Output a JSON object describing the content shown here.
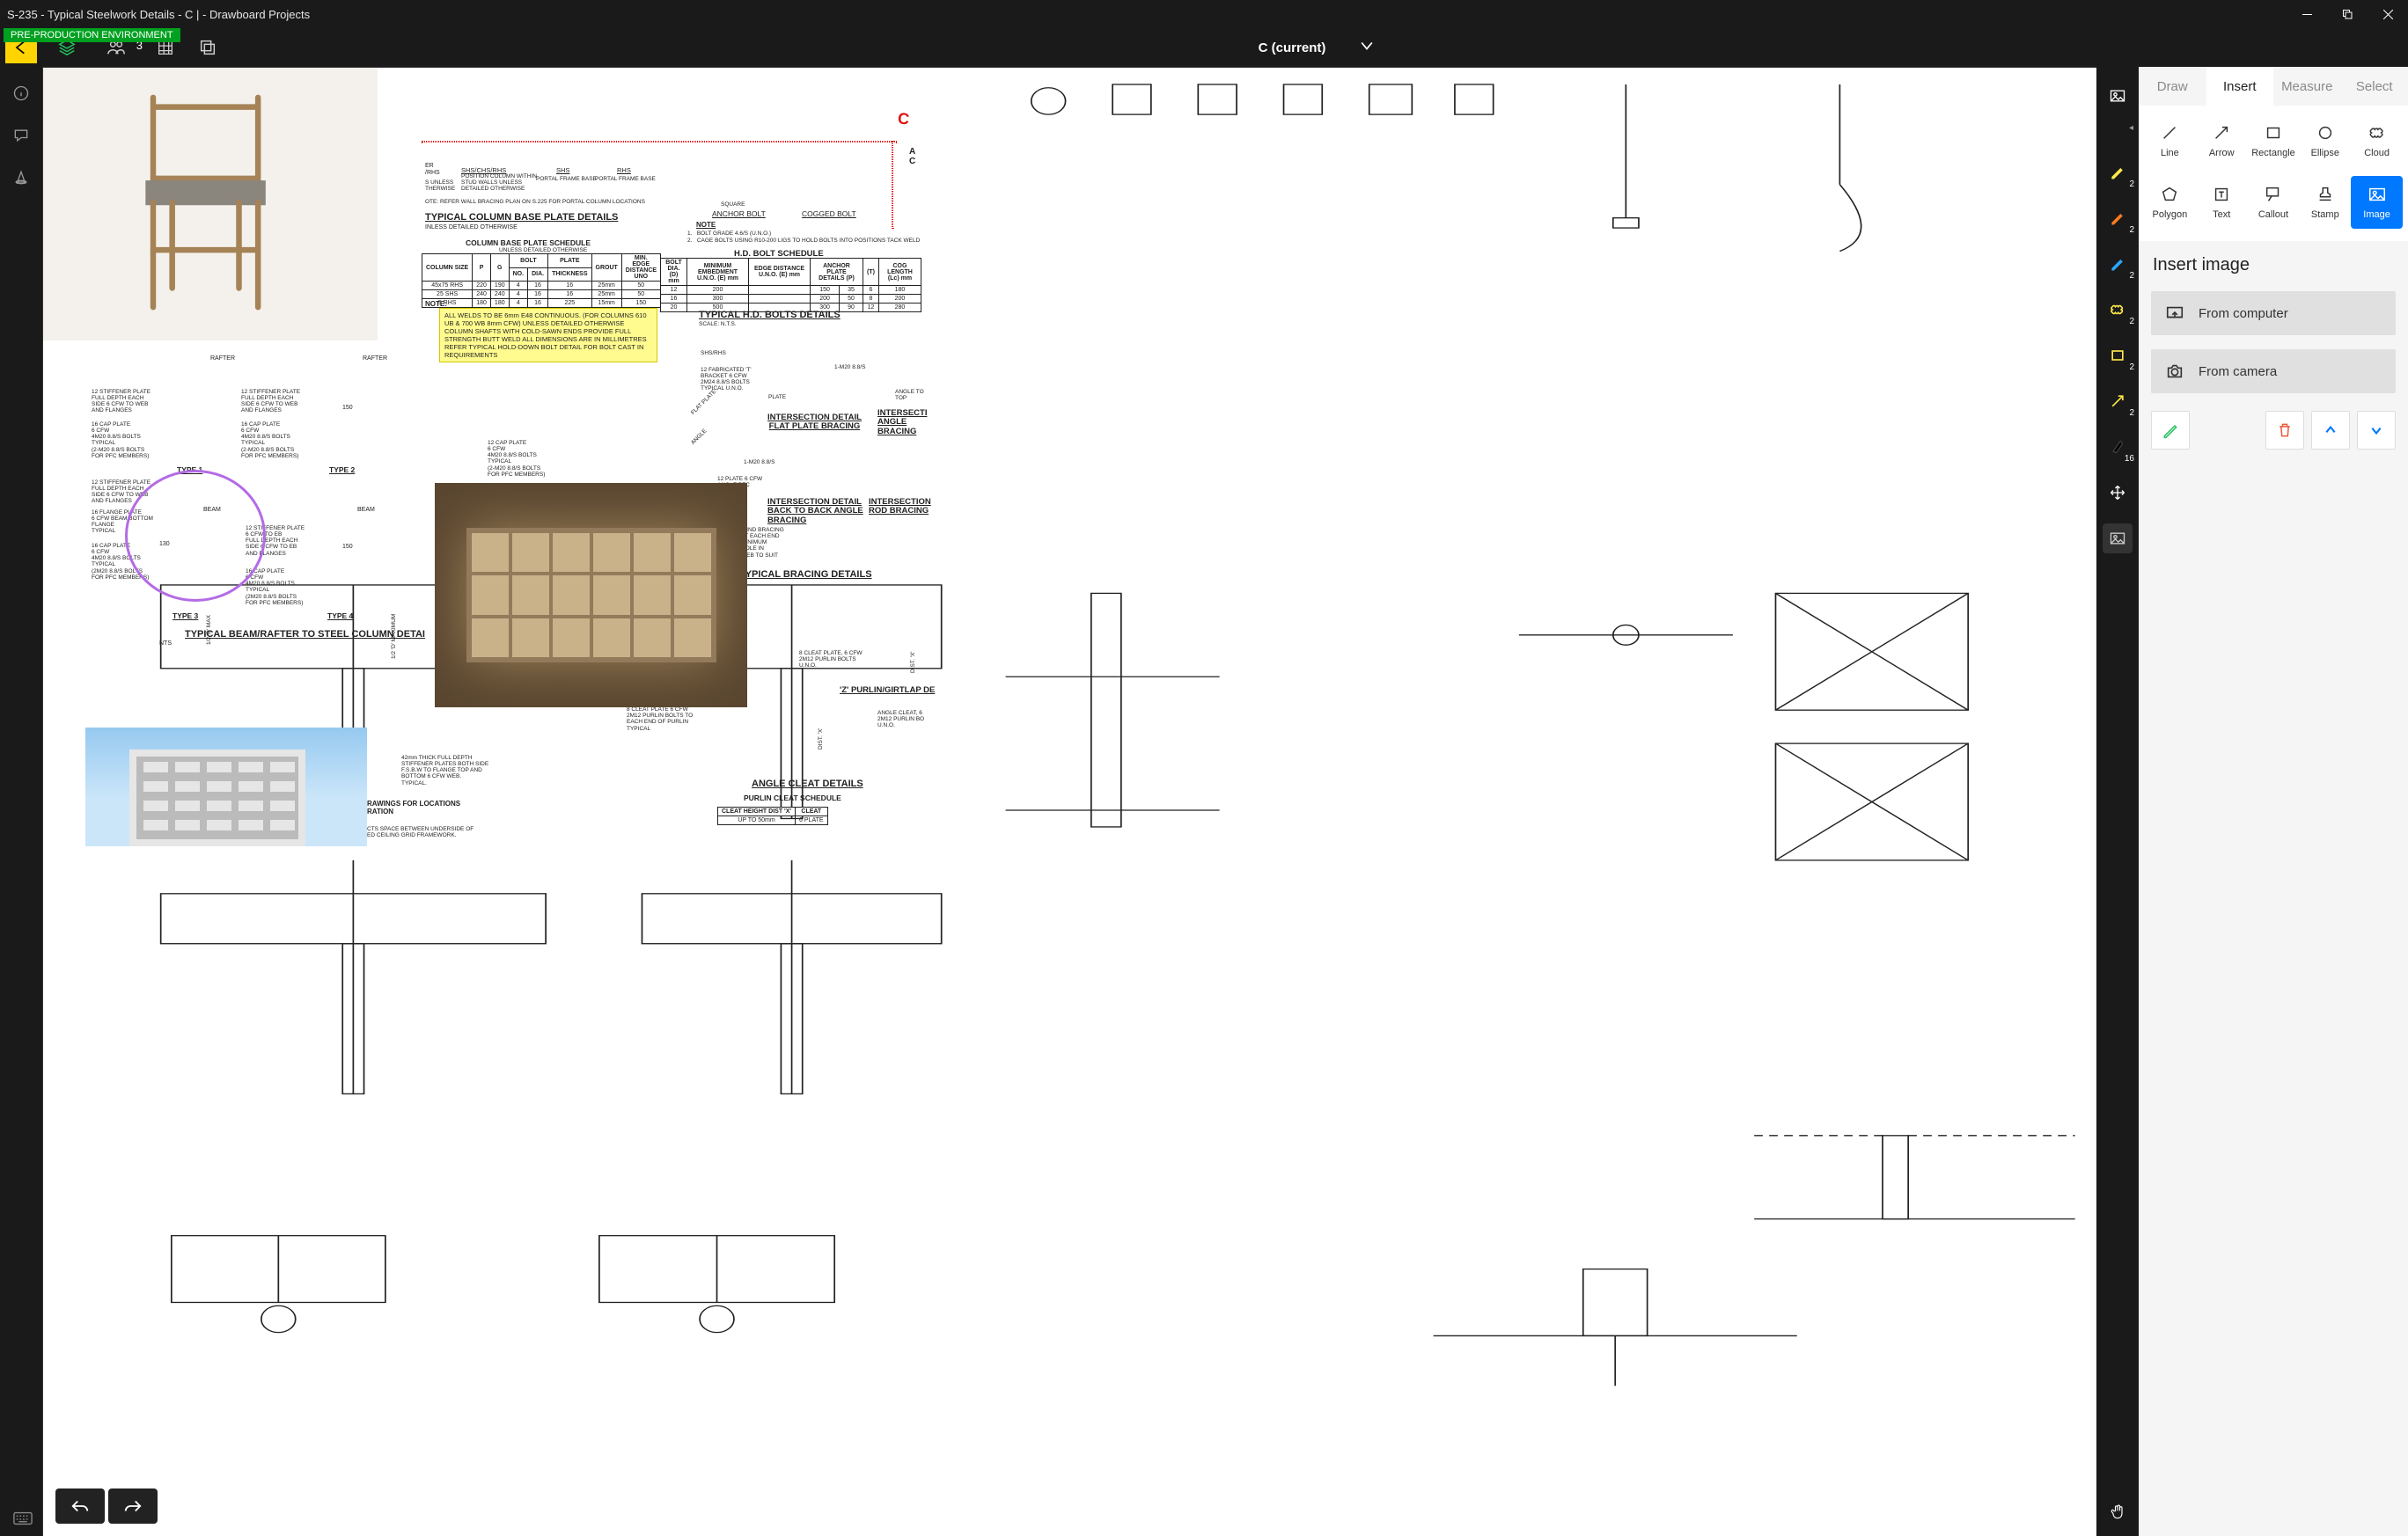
{
  "window": {
    "title": "S-235 - Typical Steelwork Details - C | - Drawboard Projects"
  },
  "env_banner": "PRE-PRODUCTION ENVIRONMENT",
  "topbar": {
    "people_count": "3",
    "revision_label": "C (current)"
  },
  "rightrail": {
    "pens": [
      {
        "color": "#ffe84a",
        "badge": "2"
      },
      {
        "color": "#ff7b1f",
        "badge": "2"
      },
      {
        "color": "#2aa7ff",
        "badge": "2"
      },
      {
        "color": "#ffe84a",
        "badge": "2",
        "square": true
      },
      {
        "color": "#ffe84a",
        "badge": "2",
        "outline": true
      },
      {
        "color": "#ffe84a",
        "badge": "2",
        "arrow": true
      }
    ],
    "ink_badge": "16"
  },
  "tabs": {
    "draw": "Draw",
    "insert": "Insert",
    "measure": "Measure",
    "select": "Select",
    "active": "insert"
  },
  "tools": {
    "line": "Line",
    "arrow": "Arrow",
    "rectangle": "Rectangle",
    "ellipse": "Ellipse",
    "cloud": "Cloud",
    "polygon": "Polygon",
    "text": "Text",
    "callout": "Callout",
    "stamp": "Stamp",
    "image": "Image",
    "selected": "image"
  },
  "insert_panel": {
    "header": "Insert image",
    "from_computer": "From computer",
    "from_camera": "From camera"
  },
  "drawing": {
    "chair_alt": "Dining chair product photo",
    "room_alt": "Interior pinboard photo",
    "building_alt": "Apartment building photo",
    "headers": {
      "col_base": "TYPICAL COLUMN BASE PLATE DETAILS",
      "base_plate_schedule": "COLUMN BASE PLATE SCHEDULE",
      "plate_note": "UNLESS DETAILED OTHERWISE",
      "hd_bolt_schedule": "H.D. BOLT SCHEDULE",
      "hd_bolts": "TYPICAL H.D. BOLTS DETAILS",
      "beam_rafter": "TYPICAL BEAM/RAFTER TO STEEL COLUMN DETAI",
      "intersection_flat": "INTERSECTION DETAIL\nFLAT PLATE BRACING",
      "intersection_angle": "INTERSECTI\nANGLE\nBRACING",
      "intersection_back": "INTERSECTION DETAIL\nBACK TO BACK ANGLE\nBRACING",
      "intersection_rod": "INTERSECTION\nROD BRACING",
      "typ_bracing": "TYPICAL BRACING DETAILS",
      "angle_cleat": "ANGLE CLEAT DETAILS",
      "purlin_sched": "PURLIN CLEAT SCHEDULE",
      "purlin_girtlap": "'Z' PURLIN/GIRTLAP DE",
      "type1": "TYPE 1",
      "type2": "TYPE 2",
      "type3": "TYPE 3",
      "type4": "TYPE 4",
      "nts": "NTS"
    },
    "small_labels": {
      "shs": "SHS",
      "rhs": "RHS",
      "shs_chs_rhs": "SHS/CHS/RHS",
      "portal_frame": "PORTAL FRAME BASE",
      "position_note": "POSITION COLUMN WITHIN\nSTUD WALLS UNLESS\nDETAILED OTHERWISE",
      "refer_wall": "OTE: REFER WALL BRACING PLAN ON S.225 FOR PORTAL COLUMN LOCATIONS",
      "weld_note": "ALL WELDS TO BE 6mm E48 CONTINUOUS. (FOR COLUMNS 610 UB & 700 WB 8mm CFW)\nUNLESS DETAILED OTHERWISE\nCOLUMN SHAFTS WITH COLD-SAWN ENDS PROVIDE FULL STRENGTH BUTT WELD\nALL DIMENSIONS ARE IN MILLIMETRES\nREFER TYPICAL HOLD-DOWN BOLT DETAIL FOR BOLT CAST IN REQUIREMENTS",
      "note_word": "NOTE:",
      "anchor": "ANCHOR BOLT",
      "cogged": "COGGED BOLT",
      "bolt_note1": "1.   BOLT GRADE 4.6/S (U.N.O.)",
      "bolt_note2": "2.   CAGE BOLTS USING R10-200 LIGS TO HOLD BOLTS INTO POSITIONS TACK WELD",
      "square": "SQUARE",
      "rafter": "RAFTER",
      "beam": "BEAM",
      "dim150": "150",
      "dim130": "130",
      "scale_nts": "SCALE: N.T.S.",
      "d_max": "1/2 'D' MAX",
      "d_maximum": "1/2 'D' MAXIMUM",
      "note_hdr": "NOTE",
      "shs_rhs": "SHS/RHS",
      "fab_t": "12 FABRICATED 'T'\nBRACKET 6 CFW\n2M24 8.8/S BOLTS\nTYPICAL U.N.O.",
      "plate_word": "PLATE",
      "angle_pfc": "ANGLE/PFC",
      "flatplate_r": "FLAT PLATE",
      "angle_to": "ANGLE TO\nTOP",
      "angle_r": "ANGLE",
      "m20": "1-M20 8.8/S",
      "m20b": "1-M20 8.8/S",
      "plate6": "12 PLATE 6 CFW\nANGLE/PFC",
      "plate12": "12 STIFFENER PLATE\nFULL DEPTH EACH\nSIDE 6 CFW TO WEB\nAND FLANGES",
      "plate12b": "12 STIFFENER PLATE\n6 CFW TO EB\nFULL DEPTH EACH\nSIDE 6 CFW TO EB\nAND FLANGES",
      "cap12": "12 CAP PLATE\n6 CFW\n4M20 8.8/S BOLTS\nTYPICAL\n(2-M20 8.8/S BOLTS\nFOR PFC MEMBERS)",
      "cap16": "16 CAP PLATE\n6 CFW\n4M20 8.8/S BOLTS\nTYPICAL\n(2-M20 8.8/S BOLTS\nFOR PFC MEMBERS)",
      "cap16s": "16 CAP PLATE\n6 CFW\n4M20 8.8/S BOLTS\nTYPICAL\n(2M20 8.8/S BOLTS\nFOR PFC MEMBERS)",
      "flange16": "16 FLANGE PLATE\n6 CFW BEAM BOTTOM\nFLANGE\nTYPICAL",
      "wind_note": "WIND BRACING\nET EACH END\nMINIMUM\nHOLE IN\nWEB TO SUIT",
      "cleat8": "8 CLEAT PLATE, 6 CFW\n2M12 PURLIN BOLTS\nU.N.O.",
      "anglecleat": "ANGLE CLEAT, 6\n2M12 PURLIN BO\nU.N.O.",
      "cleat_angle": "ANGLE CLEAT PLUS\n8 CLEAT PLATE 6 CFW\n2M12 PURLIN BOLTS TO\nEACH END OF PURLIN\nTYPICAL",
      "thick42": "42mm THICK FULL DEPTH\nSTIFFENER PLATES BOTH SIDE\nF.S.B.W TO FLANGE TOP AND\nBOTTOM 6 CFW WEB.\nTYPICAL.",
      "rawings": "RAWINGS FOR LOCATIONS\nRATION",
      "ceil_space": "CTS SPACE BETWEEN UNDERSIDE OF\nED CEILING GRID FRAMEWORK.",
      "dist_x": "DIST. 'X'",
      "er_rhs": "ER\n/RHS",
      "s_unless": "S UNLESS\nTHERWISE",
      "a_c": "A\nC",
      "inless": "INLESS DETAILED OTHERWISE",
      "up50": "UP TO 50mm",
      "pl6": "6 PLATE",
      "cleat_hdr": "CLEAT HEIGHT DIST 'X'",
      "cleat_hdr2": "CLEAT"
    },
    "base_plate_table": {
      "cols": [
        "COLUMN SIZE",
        "P",
        "G",
        "BOLT",
        "PLATE",
        "GROUT",
        "MIN. EDGE DISTANCE UNO"
      ],
      "sub": [
        "NO.",
        "DIA.",
        "THICKNESS"
      ],
      "rows": [
        [
          "45x75 RHS",
          "220",
          "190",
          "4",
          "16",
          "16",
          "25mm",
          "50"
        ],
        [
          "25 SHS",
          "240",
          "240",
          "4",
          "16",
          "16",
          "25mm",
          "50"
        ],
        [
          "9 RHS",
          "180",
          "180",
          "4",
          "16",
          "225",
          "15mm",
          "150"
        ]
      ]
    },
    "hd_table": {
      "cols": [
        "BOLT DIA. (D) mm",
        "MINIMUM EMBEDMENT U.N.O. (E) mm",
        "EDGE DISTANCE U.N.O. (E) mm",
        "ANCHOR PLATE DETAILS (P)",
        "(T)",
        "COG LENGTH (Lc) mm"
      ],
      "rows": [
        [
          "12",
          "200",
          "",
          "150",
          "35",
          "6",
          "180"
        ],
        [
          "16",
          "300",
          "",
          "200",
          "50",
          "8",
          "200"
        ],
        [
          "20",
          "500",
          "",
          "300",
          "90",
          "12",
          "280"
        ]
      ]
    }
  }
}
